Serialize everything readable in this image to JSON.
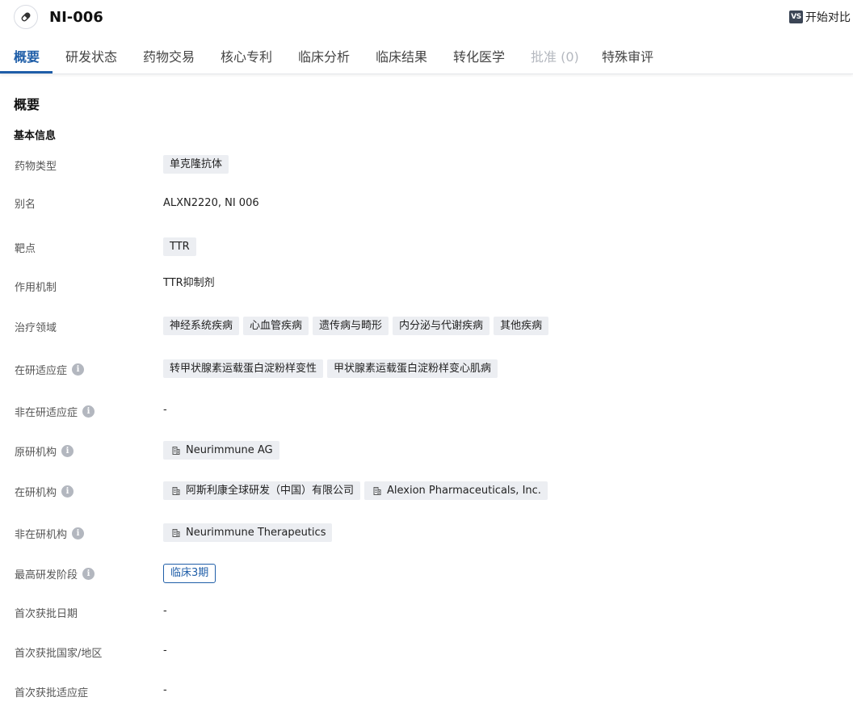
{
  "header": {
    "title": "NI-006",
    "compare_badge": "VS",
    "compare_label": "开始对比",
    "drug_icon": "pill-icon"
  },
  "tabs": [
    {
      "label": "概要",
      "active": true
    },
    {
      "label": "研发状态"
    },
    {
      "label": "药物交易"
    },
    {
      "label": "核心专利"
    },
    {
      "label": "临床分析"
    },
    {
      "label": "临床结果"
    },
    {
      "label": "转化医学"
    },
    {
      "label": "批准 (0)",
      "disabled": true
    },
    {
      "label": "特殊审评"
    }
  ],
  "overview": {
    "title": "概要",
    "basic_info_title": "基本信息",
    "info_icon": "i",
    "rows": {
      "drug_type": {
        "label": "药物类型",
        "tags": [
          "单克隆抗体"
        ]
      },
      "alias": {
        "label": "别名",
        "value": "ALXN2220,  NI 006"
      },
      "target": {
        "label": "靶点",
        "tags": [
          "TTR"
        ]
      },
      "mechanism": {
        "label": "作用机制",
        "value": "TTR抑制剂"
      },
      "therapy_area": {
        "label": "治疗领域",
        "tags": [
          "神经系统疾病",
          "心血管疾病",
          "遗传病与畸形",
          "内分泌与代谢疾病",
          "其他疾病"
        ]
      },
      "active_indication": {
        "label": "在研适应症",
        "tags": [
          "转甲状腺素运载蛋白淀粉样变性",
          "甲状腺素运载蛋白淀粉样变心肌病"
        ]
      },
      "inactive_indication": {
        "label": "非在研适应症",
        "value": "-"
      },
      "originator": {
        "label": "原研机构",
        "orgs": [
          "Neurimmune AG"
        ]
      },
      "active_org": {
        "label": "在研机构",
        "orgs": [
          "阿斯利康全球研发（中国）有限公司",
          "Alexion Pharmaceuticals, Inc."
        ]
      },
      "inactive_org": {
        "label": "非在研机构",
        "orgs": [
          "Neurimmune Therapeutics"
        ]
      },
      "highest_phase": {
        "label": "最高研发阶段",
        "phase": "临床3期"
      },
      "first_approval_date": {
        "label": "首次获批日期",
        "value": "-"
      },
      "first_approval_country": {
        "label": "首次获批国家/地区",
        "value": "-"
      },
      "first_approval_indication": {
        "label": "首次获批适应症",
        "value": "-"
      }
    }
  },
  "colors": {
    "accent": "#1f5ea8",
    "tag_bg": "#eceef2",
    "disabled": "#b4b8bf"
  }
}
